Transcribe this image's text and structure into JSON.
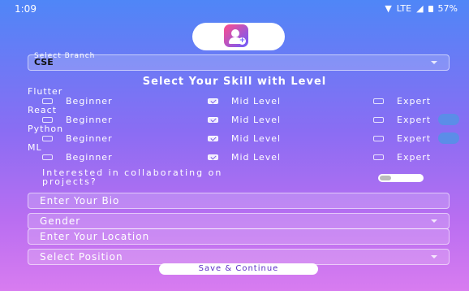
{
  "status_bar": {
    "time": "1:09",
    "network": "LTE",
    "battery": "57%"
  },
  "branch": {
    "caption": "Select Branch",
    "value": "CSE"
  },
  "heading": "Select Your Skill with Level",
  "levels": [
    "Beginner",
    "Mid Level",
    "Expert"
  ],
  "skills": [
    {
      "name": "Flutter",
      "selected": "Mid Level"
    },
    {
      "name": "React",
      "selected": "Mid Level"
    },
    {
      "name": "Python",
      "selected": "Mid Level"
    },
    {
      "name": "ML",
      "selected": "Mid Level"
    }
  ],
  "collab": {
    "line1": "Interested in collaborating on",
    "line2": "projects?",
    "enabled": false
  },
  "bio_placeholder": "Enter Your Bio",
  "gender_placeholder": "Gender",
  "location_placeholder": "Enter Your Location",
  "position_placeholder": "Select Position",
  "save_label": "Save & Continue",
  "colors": {
    "accent": "#7a5de8",
    "gradient_top": "#4f86f7",
    "gradient_bottom": "#d87cf0"
  }
}
